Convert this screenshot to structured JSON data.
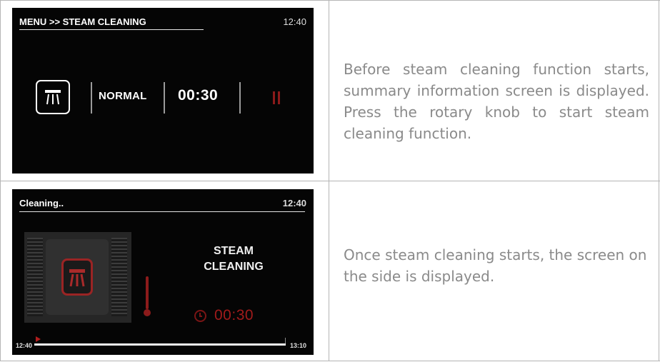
{
  "table": {
    "rows": [
      {
        "screen": {
          "breadcrumb": "MENU >> STEAM CLEANING",
          "time": "12:40",
          "mode": "NORMAL",
          "duration": "00:30",
          "icons": [
            "steam-tray-icon",
            "pause-icon"
          ]
        },
        "description": "Before steam cleaning function starts, summary information screen is displayed. Press the rotary knob to start steam cleaning function."
      },
      {
        "screen": {
          "status": "Cleaning..",
          "time": "12:40",
          "label_line1": "STEAM",
          "label_line2": "CLEANING",
          "remaining": "00:30",
          "progress_start": "12:40",
          "progress_end": "13:10",
          "progress_fraction": 0.03,
          "icons": [
            "oven-icon",
            "steam-tray-icon",
            "thermometer-icon",
            "clock-icon"
          ]
        },
        "description": "Once steam cleaning starts, the screen on the side is displayed."
      }
    ]
  }
}
